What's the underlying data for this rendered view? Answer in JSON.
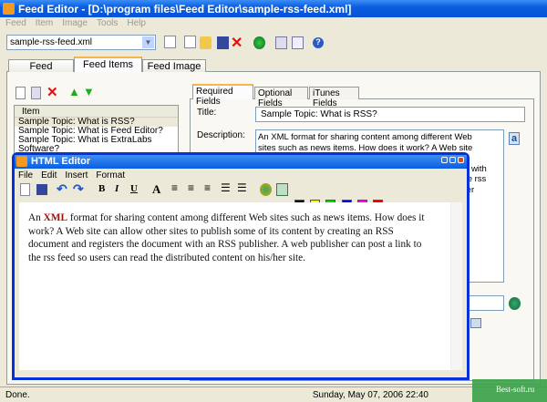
{
  "window": {
    "title": "Feed Editor - [D:\\program files\\Feed Editor\\sample-rss-feed.xml]"
  },
  "menu": [
    "Feed",
    "Item",
    "Image",
    "Tools",
    "Help"
  ],
  "toolbar": {
    "file_combo": "sample-rss-feed.xml",
    "icons": [
      "new-feed-icon",
      "new-icon",
      "open-icon",
      "save-icon",
      "delete-icon",
      "web-icon",
      "edit-icon",
      "preview-icon",
      "help-icon"
    ]
  },
  "tabs": [
    {
      "label": "Feed"
    },
    {
      "label": "Feed Items",
      "active": true
    },
    {
      "label": "Feed Image"
    }
  ],
  "items": {
    "header": "Item",
    "rows": [
      "Sample Topic: What is RSS?",
      "Sample Topic: What is Feed Editor?",
      "Sample Topic: What is ExtraLabs Software?"
    ]
  },
  "item_tabs": [
    {
      "label": "Required Fields",
      "active": true
    },
    {
      "label": "Optional Fields"
    },
    {
      "label": "iTunes Fields"
    }
  ],
  "fields": {
    "title_label": "Title:",
    "title_value": "Sample Topic: What is RSS?",
    "description_label": "Description:",
    "description_value": "An XML format for sharing content among different Web sites such as news items. How does it work? A Web site can allow other sites to publish some of its content by creating an RSS document and registers the document with an RSS publisher. A web publisher can post a link to the rss feed so users can read the distributed content on his/her site."
  },
  "html_editor": {
    "title": "HTML Editor",
    "menu": [
      "File",
      "Edit",
      "Insert",
      "Format"
    ],
    "colors": [
      "#000000",
      "#ffff00",
      "#00dd00",
      "#0000ee",
      "#ff00ff",
      "#ee0000"
    ],
    "content_prefix": "An ",
    "content_highlight": "XML",
    "content_rest": " format for sharing content among different Web sites such as news items. How does it work? A Web site can allow other sites to publish some of its content by creating an RSS document and registers the document with an RSS publisher. A web publisher can post a link to the rss feed so users can read the distributed content on his/her site."
  },
  "status": {
    "left": "Done.",
    "right": "Sunday, May 07, 2006 22:40"
  },
  "watermark": "Best-soft.ru"
}
